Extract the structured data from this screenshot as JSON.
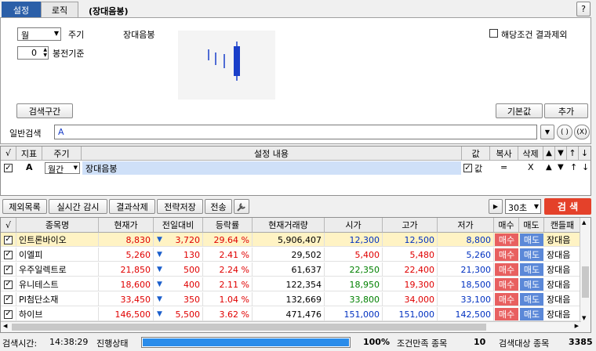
{
  "tabs": [
    {
      "label": "설정",
      "active": true
    },
    {
      "label": "로직",
      "active": false
    }
  ],
  "title": "(장대음봉)",
  "help_label": "?",
  "period": {
    "value": "월",
    "label": "주기"
  },
  "candle_offset": {
    "value": "0",
    "label": "봉전기준"
  },
  "pattern_name": "장대음봉",
  "exclude_label": "해당조건 결과제외",
  "search_range_label": "검색구간",
  "default_label": "기본값",
  "add_label": "추가",
  "general_search": {
    "label": "일반검색",
    "value": "A",
    "paren_label": "( )",
    "x_paren_label": "(X)"
  },
  "setting_grid": {
    "headers": [
      "√",
      "지표",
      "주기",
      "설정 내용",
      "값",
      "복사",
      "삭제"
    ],
    "arrows": [
      "▲",
      "▼",
      "↑",
      "↓"
    ],
    "row": {
      "indicator": "A",
      "period": "월간",
      "content": "장대음봉",
      "value_label": "값",
      "copy": "=",
      "delete": "X"
    }
  },
  "toolbar": {
    "buttons": [
      "제외목록",
      "실시간 감시",
      "결과삭제",
      "전략저장",
      "전송"
    ],
    "interval": "30초",
    "search_label": "검 색"
  },
  "colors": {
    "accent": "#e4412a",
    "buy": "#e86060",
    "sell": "#5b88d8",
    "progress": "#2a8cea"
  },
  "results": {
    "headers": [
      "√",
      "종목명",
      "현재가",
      "전일대비",
      "등락률",
      "현재거래량",
      "시가",
      "고가",
      "저가",
      "매수",
      "매도",
      "캔들패"
    ],
    "buy_label": "매수",
    "sell_label": "매도",
    "rows": [
      {
        "name": "인트론바이오",
        "price": "8,830",
        "change": "3,720",
        "rate": "29.64 %",
        "volume": "5,906,407",
        "open": "12,300",
        "high": "12,500",
        "low": "8,800",
        "open_c": "blue",
        "high_c": "blue",
        "low_c": "blue",
        "pattern": "장대음",
        "highlight": true
      },
      {
        "name": "이엘피",
        "price": "5,260",
        "change": "130",
        "rate": "2.41 %",
        "volume": "29,502",
        "open": "5,400",
        "high": "5,480",
        "low": "5,260",
        "open_c": "red",
        "high_c": "red",
        "low_c": "blue",
        "pattern": "장대음",
        "highlight": false
      },
      {
        "name": "우주일렉트로",
        "price": "21,850",
        "change": "500",
        "rate": "2.24 %",
        "volume": "61,637",
        "open": "22,350",
        "high": "22,400",
        "low": "21,300",
        "open_c": "green",
        "high_c": "red",
        "low_c": "blue",
        "pattern": "장대음",
        "highlight": false
      },
      {
        "name": "유니테스트",
        "price": "18,600",
        "change": "400",
        "rate": "2.11 %",
        "volume": "122,354",
        "open": "18,950",
        "high": "19,300",
        "low": "18,500",
        "open_c": "green",
        "high_c": "red",
        "low_c": "blue",
        "pattern": "장대음",
        "highlight": false
      },
      {
        "name": "PI첨단소재",
        "price": "33,450",
        "change": "350",
        "rate": "1.04 %",
        "volume": "132,669",
        "open": "33,800",
        "high": "34,000",
        "low": "33,100",
        "open_c": "green",
        "high_c": "red",
        "low_c": "blue",
        "pattern": "장대음",
        "highlight": false
      },
      {
        "name": "하이브",
        "price": "146,500",
        "change": "5,500",
        "rate": "3.62 %",
        "volume": "471,476",
        "open": "151,000",
        "high": "151,000",
        "low": "142,500",
        "open_c": "blue",
        "high_c": "blue",
        "low_c": "blue",
        "pattern": "장대음",
        "highlight": false
      }
    ]
  },
  "status": {
    "time_label": "검색시간:",
    "time": "14:38:29",
    "progress_label": "진행상태",
    "progress_pct": "100%",
    "progress": 1.0,
    "matched_label": "조건만족 종목",
    "matched": "10",
    "target_label": "검색대상 종목",
    "target": "3385"
  }
}
